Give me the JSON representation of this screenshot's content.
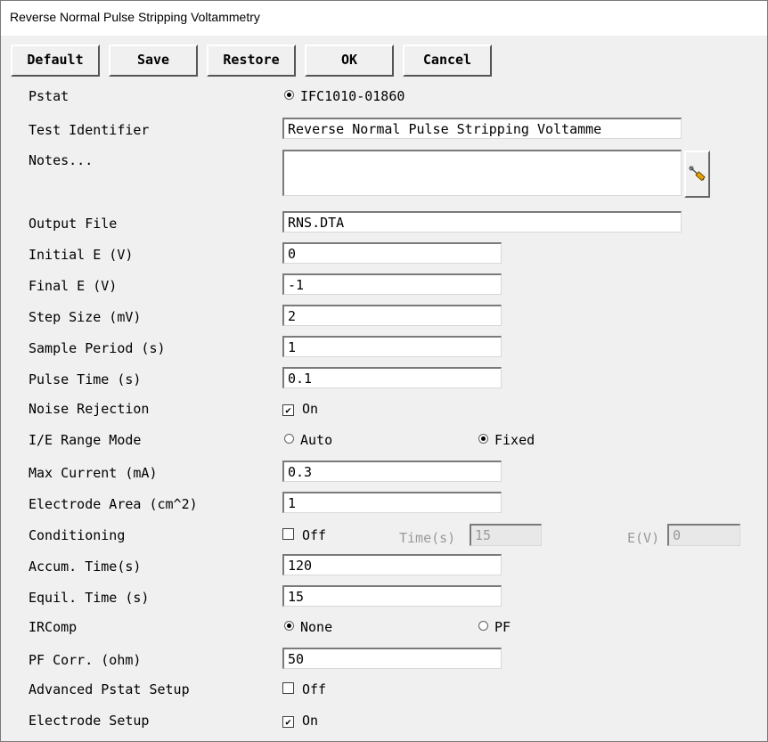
{
  "window": {
    "title": "Reverse Normal Pulse Stripping Voltammetry"
  },
  "toolbar": {
    "default_label": "Default",
    "save_label": "Save",
    "restore_label": "Restore",
    "ok_label": "OK",
    "cancel_label": "Cancel"
  },
  "form": {
    "pstat": {
      "label": "Pstat",
      "option": "IFC1010-01860",
      "selected": true
    },
    "test_identifier": {
      "label": "Test Identifier",
      "value": "Reverse Normal Pulse Stripping Voltamme"
    },
    "notes": {
      "label": "Notes...",
      "value": ""
    },
    "output_file": {
      "label": "Output File",
      "value": "RNS.DTA"
    },
    "initial_e": {
      "label": "Initial E (V)",
      "value": "0"
    },
    "final_e": {
      "label": "Final E (V)",
      "value": "-1"
    },
    "step_size": {
      "label": "Step Size (mV)",
      "value": "2"
    },
    "sample_period": {
      "label": "Sample Period (s)",
      "value": "1"
    },
    "pulse_time": {
      "label": "Pulse Time (s)",
      "value": "0.1"
    },
    "noise_rejection": {
      "label": "Noise Rejection",
      "checked": true,
      "text": "On"
    },
    "ie_range_mode": {
      "label": "I/E Range Mode",
      "option_auto": "Auto",
      "option_fixed": "Fixed",
      "selected": "Fixed"
    },
    "max_current": {
      "label": "Max Current (mA)",
      "value": "0.3"
    },
    "electrode_area": {
      "label": "Electrode Area (cm^2)",
      "value": "1"
    },
    "conditioning": {
      "label": "Conditioning",
      "checked": false,
      "text": "Off",
      "time_label": "Time(s)",
      "time_value": "15",
      "ev_label": "E(V)",
      "ev_value": "0"
    },
    "accum_time": {
      "label": "Accum. Time(s)",
      "value": "120"
    },
    "equil_time": {
      "label": "Equil. Time (s)",
      "value": "15"
    },
    "ircomp": {
      "label": "IRComp",
      "option_none": "None",
      "option_pf": "PF",
      "selected": "None"
    },
    "pf_corr": {
      "label": "PF Corr. (ohm)",
      "value": "50"
    },
    "advanced_pstat_setup": {
      "label": "Advanced Pstat Setup",
      "checked": false,
      "text": "Off"
    },
    "electrode_setup": {
      "label": "Electrode Setup",
      "checked": true,
      "text": "On"
    }
  },
  "icons": {
    "notes_editor": "pencil-icon",
    "check_mark": "✔"
  }
}
